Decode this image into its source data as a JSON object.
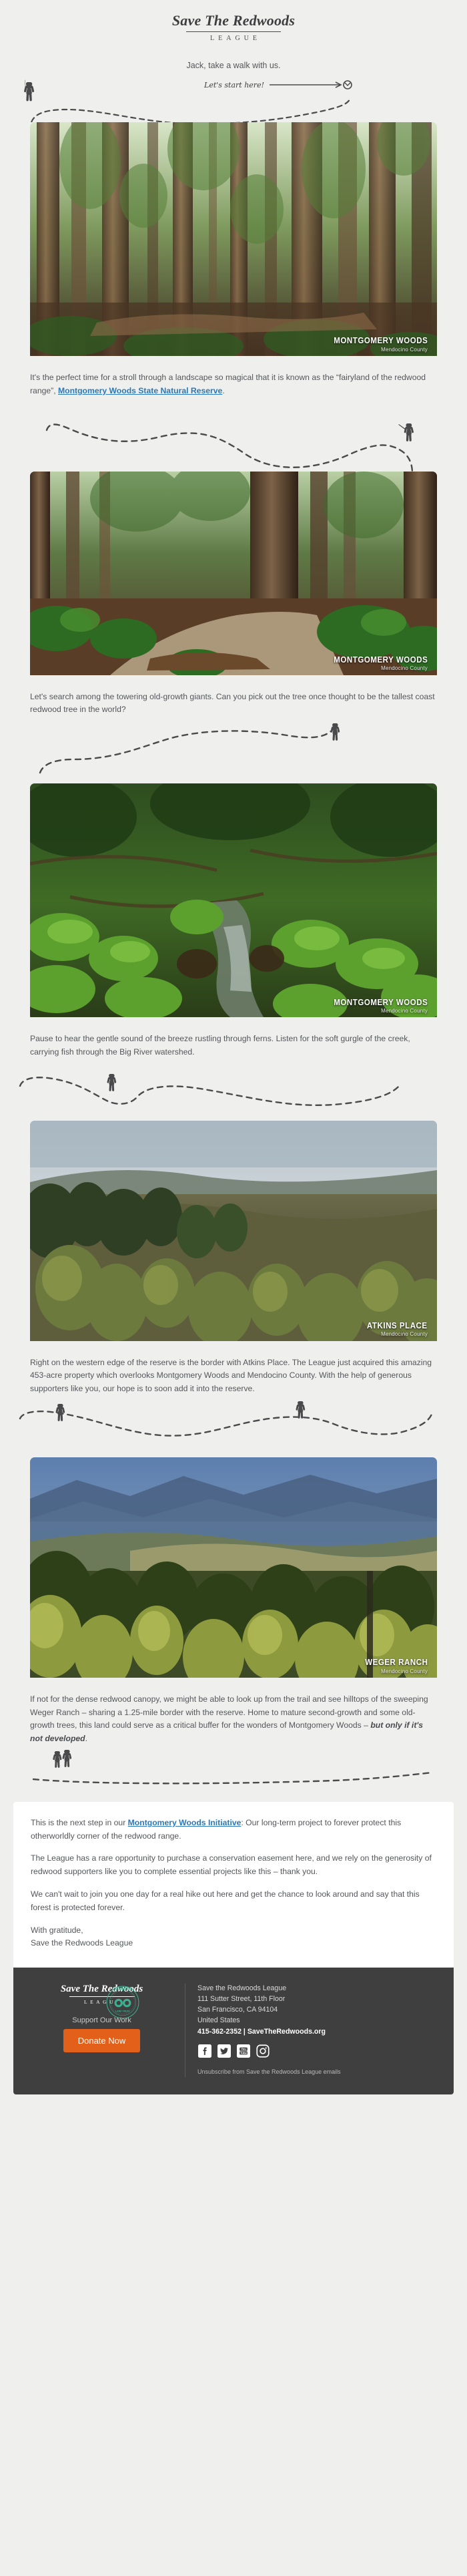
{
  "header": {
    "logo_script": "Save The Redwoods",
    "logo_league": "LEAGUE",
    "greeting": "Jack, take a walk with us.",
    "hand_note": "Let's start here!"
  },
  "sections": [
    {
      "caption_title": "MONTGOMERY WOODS",
      "caption_sub": "Mendocino County",
      "copy_prefix": "It's the perfect time for a stroll through a landscape so magical that it is known as the “fairyland of the redwood range”, ",
      "copy_link": "Montgomery Woods State Natural Reserve",
      "copy_suffix": "."
    },
    {
      "caption_title": "MONTGOMERY WOODS",
      "caption_sub": "Mendocino County",
      "copy": "Let's search among the towering old-growth giants. Can you pick out the tree once thought to be the tallest coast redwood tree in the world?"
    },
    {
      "caption_title": "MONTGOMERY WOODS",
      "caption_sub": "Mendocino County",
      "copy": "Pause to hear the gentle sound of the breeze rustling through ferns. Listen for the soft gurgle of the creek, carrying fish through the Big River watershed."
    },
    {
      "caption_title": "ATKINS PLACE",
      "caption_sub": "Mendocino County",
      "copy": "Right on the western edge of the reserve is the border with Atkins Place. The League just acquired this amazing 453-acre property which overlooks Montgomery Woods and Mendocino County. With the help of generous supporters like you, our hope is to soon add it into the reserve."
    },
    {
      "caption_title": "WEGER RANCH",
      "caption_sub": "Mendocino County",
      "copy_prefix": "If not for the dense redwood canopy, we might be able to look up from the trail and see hilltops of the sweeping Weger Ranch – sharing a 1.25-mile border with the reserve. Home to mature second-growth and some old-growth trees, this land could serve as a critical buffer for the wonders of Montgomery Woods – ",
      "copy_emphasis": "but only if it's not developed",
      "copy_suffix": "."
    }
  ],
  "closing": {
    "p1_prefix": "This is the next step in our ",
    "p1_link": "Montgomery Woods Initiative",
    "p1_suffix": ": Our long-term project to forever protect this otherworldly corner of the redwood range.",
    "p2": "The League has a rare opportunity to purchase a conservation easement here, and we rely on the generosity of redwood supporters like you to complete essential projects like this – thank you.",
    "p3": "We can't wait to join you one day for a real hike out here and get the chance to look around and say that this forest is protected forever.",
    "sign_off": "With gratitude,",
    "signature": "Save the Redwoods League"
  },
  "footer": {
    "logo_script": "Save The Redwoods",
    "logo_league": "LEAGUE",
    "support_label": "Support Our Work",
    "donate_label": "Donate Now",
    "accreditation": "ACCREDITED LAND TRUST ACCREDITATION COMMISSION",
    "org_name": "Save the Redwoods League",
    "address_line1": "111 Sutter Street, 11th Floor",
    "address_line2": "San Francisco, CA 94104",
    "address_line3": "United States",
    "contact": "415-362-2352 | SaveTheRedwoods.org",
    "social": [
      "facebook-icon",
      "twitter-icon",
      "youtube-icon",
      "instagram-icon"
    ],
    "unsubscribe": "Unsubscribe from Save the Redwoods League emails"
  },
  "colors": {
    "page_bg": "#efefed",
    "text": "#54565b",
    "link": "#2a7ab9",
    "footer_bg": "#403f3f",
    "donate": "#e2601a",
    "accred_green": "#3dae8e"
  }
}
